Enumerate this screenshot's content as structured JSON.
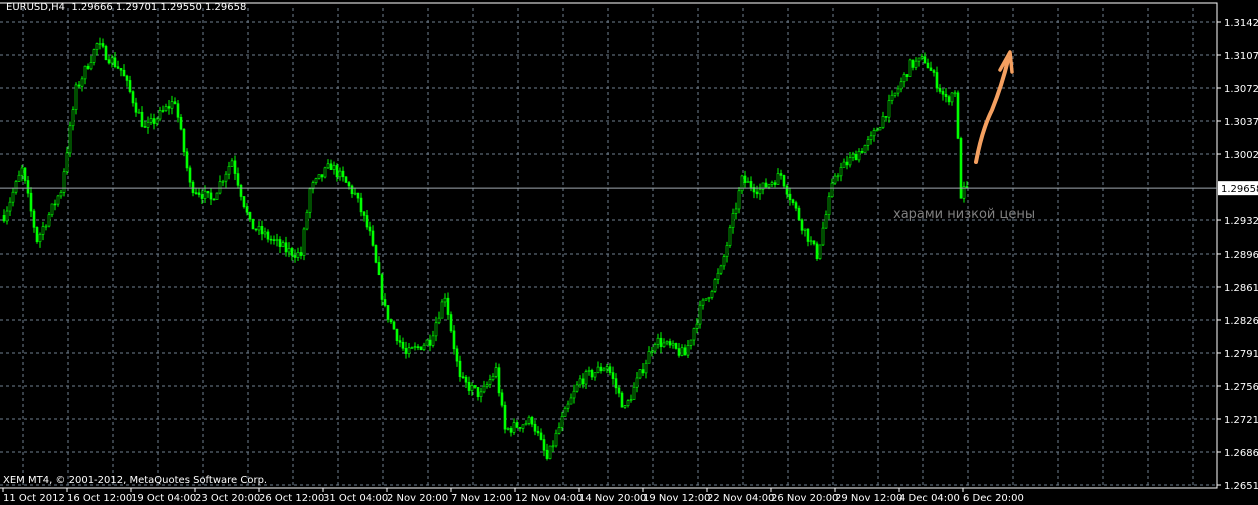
{
  "header": {
    "symbol": "EURUSD,H4",
    "open": "1.29666",
    "high": "1.29701",
    "low": "1.29550",
    "close": "1.29658"
  },
  "copyright": "XEM MT4, © 2001-2012, MetaQuotes Software Corp.",
  "annotation": "харами низкой цены",
  "colors": {
    "background": "#000000",
    "candle": "#00ff00",
    "grid": "#708090",
    "arrow": "#f5a060",
    "axis": "#ffffff"
  },
  "chart_data": {
    "type": "candlestick",
    "title": "EURUSD,H4",
    "ylim": [
      1.2651,
      1.3142
    ],
    "y_ticks": [
      "1.31420",
      "1.31070",
      "1.30720",
      "1.30370",
      "1.30020",
      "1.29320",
      "1.28960",
      "1.28610",
      "1.28260",
      "1.27910",
      "1.27560",
      "1.27210",
      "1.26860",
      "1.26510"
    ],
    "y_tick_values": [
      1.3142,
      1.3107,
      1.3072,
      1.3037,
      1.3002,
      1.2932,
      1.2896,
      1.2861,
      1.2826,
      1.2791,
      1.2756,
      1.2721,
      1.2686,
      1.2651
    ],
    "current_price": "1.29658",
    "current_price_value": 1.29658,
    "x_ticks": [
      "11 Oct 2012",
      "16 Oct 12:00",
      "19 Oct 04:00",
      "23 Oct 20:00",
      "26 Oct 12:00",
      "31 Oct 04:00",
      "2 Nov 20:00",
      "7 Nov 12:00",
      "12 Nov 04:00",
      "14 Nov 20:00",
      "19 Nov 12:00",
      "22 Nov 04:00",
      "26 Nov 20:00",
      "29 Nov 12:00",
      "4 Dec 04:00",
      "6 Dec 20:00"
    ],
    "bars_per_x_tick": 21,
    "approx_close_path": [
      [
        0,
        1.2937
      ],
      [
        6,
        1.2985
      ],
      [
        11,
        1.2911
      ],
      [
        19,
        1.2964
      ],
      [
        24,
        1.307
      ],
      [
        31,
        1.3118
      ],
      [
        39,
        1.3091
      ],
      [
        47,
        1.3028
      ],
      [
        57,
        1.3059
      ],
      [
        62,
        1.2969
      ],
      [
        69,
        1.2953
      ],
      [
        76,
        1.2996
      ],
      [
        82,
        1.2927
      ],
      [
        94,
        1.29
      ],
      [
        99,
        1.2895
      ],
      [
        102,
        1.2964
      ],
      [
        109,
        1.299
      ],
      [
        117,
        1.2959
      ],
      [
        122,
        1.2916
      ],
      [
        127,
        1.2837
      ],
      [
        134,
        1.2789
      ],
      [
        142,
        1.2805
      ],
      [
        147,
        1.2853
      ],
      [
        152,
        1.2762
      ],
      [
        159,
        1.2746
      ],
      [
        164,
        1.2773
      ],
      [
        167,
        1.2709
      ],
      [
        176,
        1.272
      ],
      [
        181,
        1.2678
      ],
      [
        186,
        1.272
      ],
      [
        192,
        1.2762
      ],
      [
        201,
        1.2778
      ],
      [
        207,
        1.2731
      ],
      [
        217,
        1.2805
      ],
      [
        227,
        1.2789
      ],
      [
        232,
        1.2837
      ],
      [
        239,
        1.2879
      ],
      [
        246,
        1.2974
      ],
      [
        252,
        1.2964
      ],
      [
        259,
        1.298
      ],
      [
        266,
        1.2927
      ],
      [
        271,
        1.2895
      ],
      [
        277,
        1.298
      ],
      [
        289,
        1.3017
      ],
      [
        296,
        1.3059
      ],
      [
        302,
        1.3096
      ],
      [
        307,
        1.3102
      ],
      [
        314,
        1.3059
      ],
      [
        317,
        1.307
      ],
      [
        319,
        1.2959
      ],
      [
        321,
        1.29658
      ]
    ],
    "annotations": [
      "харами низкой цены",
      "up-arrow"
    ]
  }
}
